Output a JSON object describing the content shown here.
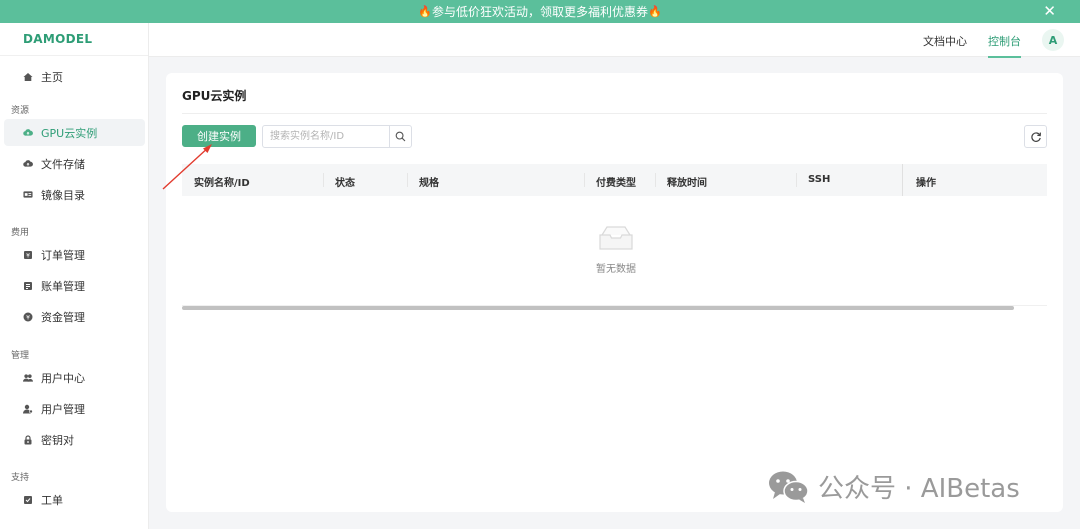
{
  "banner": {
    "text": "参与低价狂欢活动，领取更多福利优惠券",
    "fire": "🔥",
    "close": "✕"
  },
  "sidebar": {
    "logo": "DAMODEL",
    "home": {
      "label": "主页",
      "icon": "home-icon"
    },
    "sections": [
      {
        "label": "资源",
        "items": [
          {
            "label": "GPU云实例",
            "icon": "cloud-icon",
            "active": true
          },
          {
            "label": "文件存储",
            "icon": "cloud-storage-icon"
          },
          {
            "label": "镜像目录",
            "icon": "image-catalog-icon"
          }
        ]
      },
      {
        "label": "费用",
        "items": [
          {
            "label": "订单管理",
            "icon": "order-icon"
          },
          {
            "label": "账单管理",
            "icon": "bill-icon"
          },
          {
            "label": "资金管理",
            "icon": "fund-icon"
          }
        ]
      },
      {
        "label": "管理",
        "items": [
          {
            "label": "用户中心",
            "icon": "users-icon"
          },
          {
            "label": "用户管理",
            "icon": "user-manage-icon"
          },
          {
            "label": "密钥对",
            "icon": "lock-icon"
          }
        ]
      },
      {
        "label": "支持",
        "items": [
          {
            "label": "工单",
            "icon": "ticket-icon"
          }
        ]
      }
    ]
  },
  "topbar": {
    "docs": "文档中心",
    "console": "控制台",
    "avatar": "A"
  },
  "main": {
    "title": "GPU云实例",
    "create_button": "创建实例",
    "search_placeholder": "搜索实例名称/ID",
    "columns": [
      "实例名称/ID",
      "状态",
      "规格",
      "付费类型",
      "释放时间",
      "SSH",
      "操作"
    ],
    "empty_text": "暂无数据"
  },
  "watermark": {
    "text": "公众号 · AIBetas"
  },
  "colors": {
    "accent": "#4caf87",
    "banner": "#5bbf9b",
    "arrow": "#e23b2e"
  }
}
